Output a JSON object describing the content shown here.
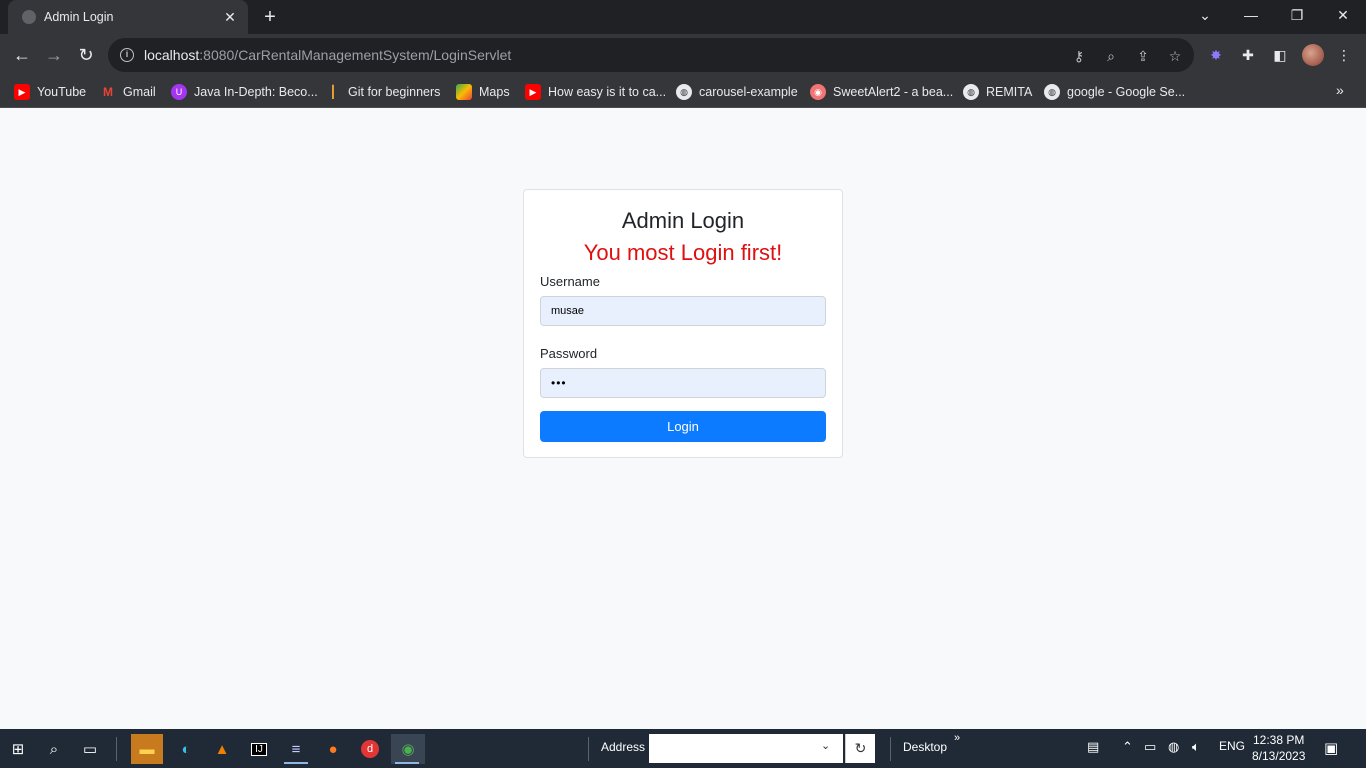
{
  "browser": {
    "tab_title": "Admin Login",
    "tab_close": "✕",
    "new_tab": "+",
    "url_host": "localhost",
    "url_path": ":8080/CarRentalManagementSystem/LoginServlet",
    "window_controls": {
      "tab_search": "⌄",
      "minimize": "—",
      "restore": "❐",
      "close": "✕"
    },
    "nav": {
      "back": "←",
      "forward": "→",
      "reload": "↻"
    },
    "bookmarks": [
      {
        "label": "YouTube",
        "icon": "youtube-icon",
        "color": "#ff0000"
      },
      {
        "label": "Gmail",
        "icon": "gmail-icon",
        "color": "#ea4335"
      },
      {
        "label": "Java In-Depth: Beco...",
        "icon": "udemy-icon",
        "color": "#a435f0"
      },
      {
        "label": "Git for beginners",
        "icon": "git-icon",
        "color": "#f0a030"
      },
      {
        "label": "Maps",
        "icon": "maps-icon",
        "color": "#34a853"
      },
      {
        "label": "How easy is it to ca...",
        "icon": "youtube-icon",
        "color": "#ff0000"
      },
      {
        "label": "carousel-example",
        "icon": "globe-icon",
        "color": "#e8eaed"
      },
      {
        "label": "SweetAlert2 - a bea...",
        "icon": "sweetalert-icon",
        "color": "#f27474"
      },
      {
        "label": "REMITA",
        "icon": "globe-icon",
        "color": "#e8eaed"
      },
      {
        "label": "google - Google Se...",
        "icon": "globe-icon",
        "color": "#e8eaed"
      }
    ],
    "bookmarks_more": "»"
  },
  "login": {
    "title": "Admin Login",
    "error": "You most Login first!",
    "username_label": "Username",
    "username_value": "musae",
    "password_label": "Password",
    "password_value": "•••",
    "submit_label": "Login"
  },
  "taskbar": {
    "address_label": "Address",
    "address_value": "",
    "desktop_label": "Desktop",
    "desktop_more": "»",
    "language": "ENG",
    "time": "12:38 PM",
    "date": "8/13/2023"
  },
  "colors": {
    "primary": "#0d7bff",
    "error": "#e01010",
    "tab_bg": "#35363a",
    "titlebar_bg": "#202124",
    "taskbar_bg": "#1f2a36",
    "autofill_bg": "#e8f0fe"
  }
}
